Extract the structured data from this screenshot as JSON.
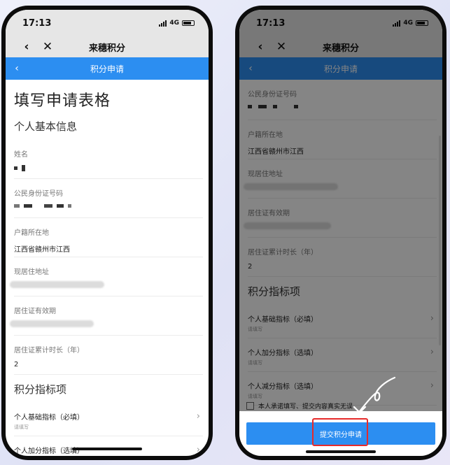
{
  "status_time": "17:13",
  "network": "4G",
  "nav": {
    "title": "来穗积分"
  },
  "page": {
    "title": "积分申请"
  },
  "form_title": "填写申请表格",
  "section_basic": "个人基本信息",
  "fields": {
    "name": {
      "label": "姓名"
    },
    "id_number": {
      "label": "公民身份证号码"
    },
    "household": {
      "label": "户籍所在地",
      "value": "江西省赣州市江西"
    },
    "address": {
      "label": "现居住地址"
    },
    "permit_validity": {
      "label": "居住证有效期"
    },
    "permit_years": {
      "label": "居住证累计时长（年）",
      "value": "2"
    }
  },
  "section_index": "积分指标项",
  "index_items": [
    {
      "label": "个人基础指标（必填）",
      "placeholder": "请填写"
    },
    {
      "label": "个人加分指标（选填）",
      "placeholder": "请填写"
    },
    {
      "label": "个人减分指标（选填）",
      "placeholder": "请填写"
    }
  ],
  "pledge": "本人承诺填写、提交内容真实无误",
  "submit_label": "提交积分申请",
  "colors": {
    "primary": "#2c8ef1",
    "highlight": "#e62a2a"
  },
  "icons": {
    "back": "chevron-left-icon",
    "close": "close-icon",
    "more": "chevron-right-icon"
  }
}
